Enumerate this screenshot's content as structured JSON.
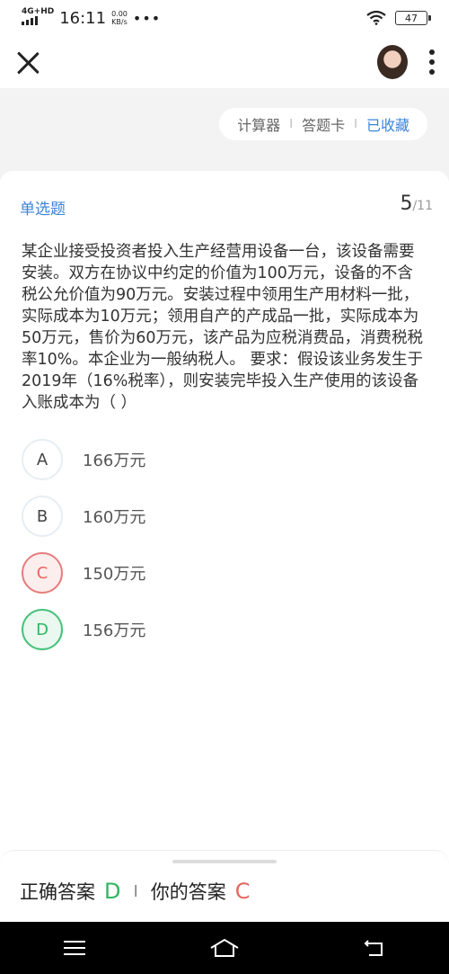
{
  "status_bar": {
    "network": "4G+HD",
    "time": "16:11",
    "speed_value": "0.00",
    "speed_unit": "KB/s",
    "more": "•••",
    "battery": "47"
  },
  "toolbar": {
    "calculator": "计算器",
    "answer_card": "答题卡",
    "favorited": "已收藏",
    "separator": "I"
  },
  "question": {
    "type": "单选题",
    "current": "5",
    "total": "/11",
    "text": "某企业接受投资者投入生产经营用设备一台，该设备需要安装。双方在协议中约定的价值为100万元，设备的不含税公允价值为90万元。安装过程中领用生产用材料一批，实际成本为10万元；领用自产的产成品一批，实际成本为50万元，售价为60万元，该产品为应税消费品，消费税税率10%。本企业为一般纳税人。 要求：假设该业务发生于2019年（16%税率），则安装完毕投入生产使用的该设备入账成本为（    ）"
  },
  "options": [
    {
      "letter": "A",
      "text": "166万元",
      "state": "normal"
    },
    {
      "letter": "B",
      "text": "160万元",
      "state": "normal"
    },
    {
      "letter": "C",
      "text": "150万元",
      "state": "wrong"
    },
    {
      "letter": "D",
      "text": "156万元",
      "state": "correct"
    }
  ],
  "answer": {
    "correct_label": "正确答案",
    "correct_value": "D",
    "divider": "I",
    "your_label": "你的答案",
    "your_value": "C"
  },
  "colors": {
    "accent": "#3b84d8",
    "correct": "#30b562",
    "wrong": "#e6665e"
  }
}
